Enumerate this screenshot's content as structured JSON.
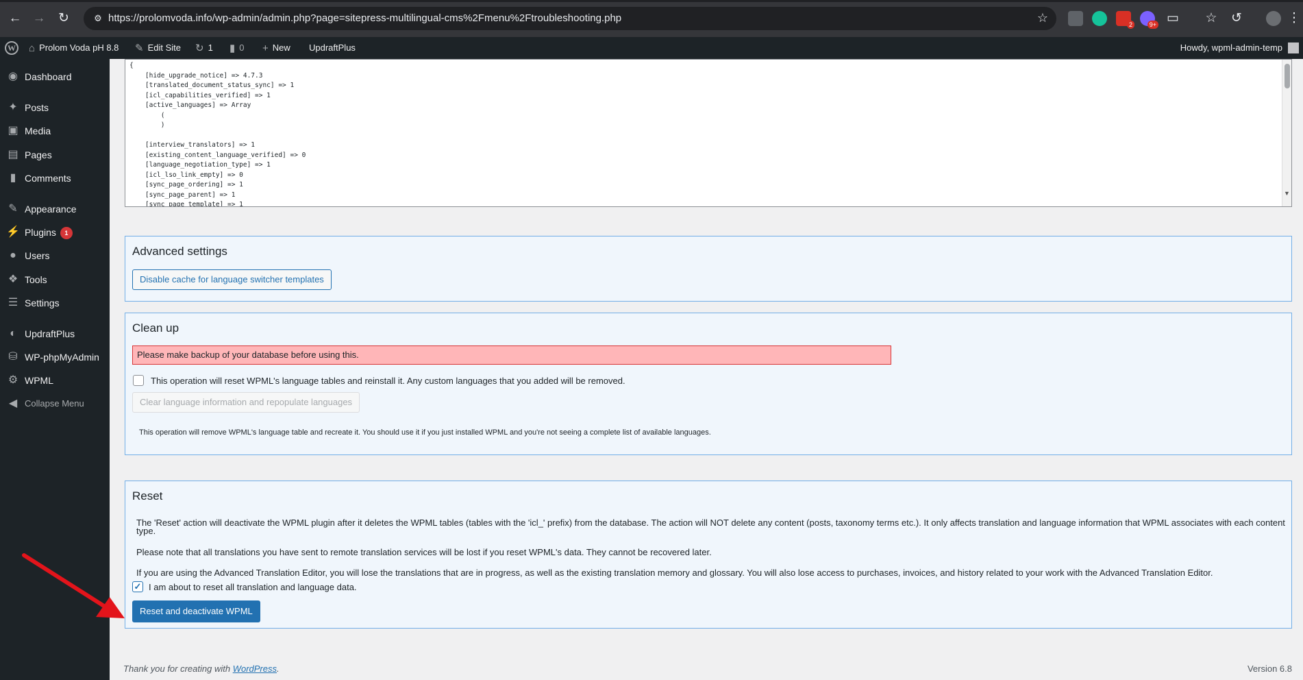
{
  "browser": {
    "url": "https://prolomvoda.info/wp-admin/admin.php?page=sitepress-multilingual-cms%2Fmenu%2Ftroubleshooting.php",
    "extension_badges": [
      "2",
      "9+"
    ]
  },
  "adminbar": {
    "site_name": "Prolom Voda pH 8.8",
    "edit_site": "Edit Site",
    "updates_count": "1",
    "comments_count": "0",
    "new_label": "New",
    "updraftplus": "UpdraftPlus",
    "howdy": "Howdy, wpml-admin-temp"
  },
  "sidebar": {
    "items": [
      {
        "label": "Dashboard",
        "icon": "dashboard-icon"
      },
      {
        "label": "Posts",
        "icon": "pin-icon"
      },
      {
        "label": "Media",
        "icon": "media-icon"
      },
      {
        "label": "Pages",
        "icon": "pages-icon"
      },
      {
        "label": "Comments",
        "icon": "comment-icon"
      },
      {
        "label": "Appearance",
        "icon": "brush-icon"
      },
      {
        "label": "Plugins",
        "icon": "plugin-icon",
        "badge": "1"
      },
      {
        "label": "Users",
        "icon": "user-icon"
      },
      {
        "label": "Tools",
        "icon": "wrench-icon"
      },
      {
        "label": "Settings",
        "icon": "settings-icon"
      },
      {
        "label": "UpdraftPlus",
        "icon": "updraft-icon"
      },
      {
        "label": "WP-phpMyAdmin",
        "icon": "database-icon"
      },
      {
        "label": "WPML",
        "icon": "gear-icon"
      },
      {
        "label": "Collapse Menu",
        "icon": "collapse-icon"
      }
    ]
  },
  "debug_output": "{\n    [hide_upgrade_notice] => 4.7.3\n    [translated_document_status_sync] => 1\n    [icl_capabilities_verified] => 1\n    [active_languages] => Array\n        (\n        )\n\n    [interview_translators] => 1\n    [existing_content_language_verified] => 0\n    [language_negotiation_type] => 1\n    [icl_lso_link_empty] => 0\n    [sync_page_ordering] => 1\n    [sync_page_parent] => 1\n    [sync_page_template] => 1",
  "advanced": {
    "title": "Advanced settings",
    "button": "Disable cache for language switcher templates"
  },
  "cleanup": {
    "title": "Clean up",
    "warning": "Please make backup of your database before using this.",
    "checkbox_label": "This operation will reset WPML's language tables and reinstall it. Any custom languages that you added will be removed.",
    "button": "Clear language information and repopulate languages",
    "note": "This operation will remove WPML's language table and recreate it. You should use it if you just installed WPML and you're not seeing a complete list of available languages."
  },
  "reset": {
    "title": "Reset",
    "para1_line1": "The 'Reset' action will deactivate the WPML plugin after it deletes the WPML tables (tables with the 'icl_' prefix) from the database. The action will NOT delete any content (posts, taxonomy terms etc.). It only affects translation and language information that WPML associates with each content",
    "para1_line2": "type.",
    "para2": "Please note that all translations you have sent to remote translation services will be lost if you reset WPML's data. They cannot be recovered later.",
    "para3": "If you are using the Advanced Translation Editor, you will lose the translations that are in progress, as well as the existing translation memory and glossary. You will also lose access to purchases, invoices, and history related to your work with the Advanced Translation Editor.",
    "checkbox_label": "I am about to reset all translation and language data.",
    "checkbox_checked": true,
    "button": "Reset and deactivate WPML"
  },
  "footer": {
    "thanks_prefix": "Thank you for creating with ",
    "thanks_link": "WordPress",
    "thanks_suffix": ".",
    "version": "Version 6.8"
  },
  "colors": {
    "admin_dark": "#1d2327",
    "accent": "#2271b1",
    "warning_bg": "#ffb6b8",
    "annotation_arrow": "#e3141b"
  }
}
